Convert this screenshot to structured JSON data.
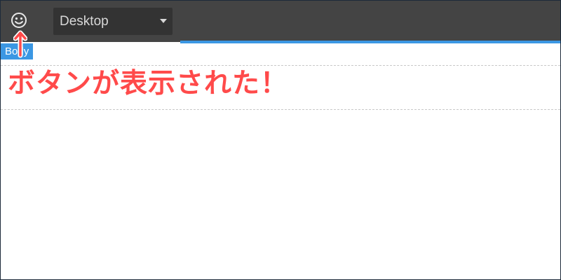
{
  "toolbar": {
    "smiley_icon": "smiley-face-icon",
    "device_select": {
      "selected": "Desktop"
    },
    "colors": {
      "background": "#444444",
      "select_background": "#333333",
      "accent": "#3b97e3"
    }
  },
  "canvas": {
    "body_badge": "Body",
    "annotation_text": "ボタンが表示された！",
    "colors": {
      "annotation": "#ff4a4a",
      "badge": "#3b97e3"
    }
  }
}
